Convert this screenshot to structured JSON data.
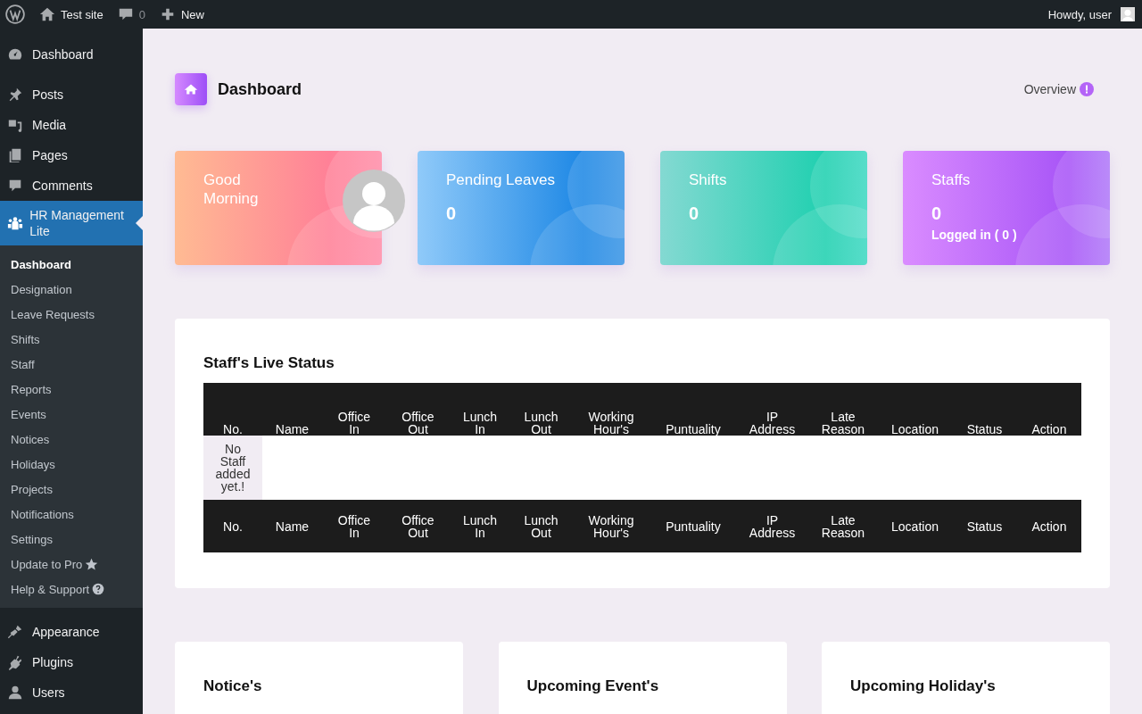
{
  "admin_bar": {
    "site": "Test site",
    "comments": "0",
    "new": "New",
    "greeting": "Howdy, user"
  },
  "sidebar": {
    "items": [
      {
        "label": "Dashboard",
        "selected": false
      },
      {
        "label": "Posts",
        "selected": false
      },
      {
        "label": "Media",
        "selected": false
      },
      {
        "label": "Pages",
        "selected": false
      },
      {
        "label": "Comments",
        "selected": false
      },
      {
        "label": "HR Management Lite",
        "selected": true
      }
    ],
    "submenu": [
      {
        "label": "Dashboard",
        "selected": true,
        "kind": "link"
      },
      {
        "label": "Designation",
        "selected": false,
        "kind": "link"
      },
      {
        "label": "Leave Requests",
        "selected": false,
        "kind": "link"
      },
      {
        "label": "Shifts",
        "selected": false,
        "kind": "link"
      },
      {
        "label": "Staff",
        "selected": false,
        "kind": "link"
      },
      {
        "label": "Reports",
        "selected": false,
        "kind": "link"
      },
      {
        "label": "Events",
        "selected": false,
        "kind": "link"
      },
      {
        "label": "Notices",
        "selected": false,
        "kind": "link"
      },
      {
        "label": "Holidays",
        "selected": false,
        "kind": "link"
      },
      {
        "label": "Projects",
        "selected": false,
        "kind": "link"
      },
      {
        "label": "Notifications",
        "selected": false,
        "kind": "link"
      },
      {
        "label": "Settings",
        "selected": false,
        "kind": "link"
      },
      {
        "label": "Update to Pro",
        "selected": false,
        "kind": "pro"
      },
      {
        "label": "Help & Support",
        "selected": false,
        "kind": "help"
      }
    ],
    "lower_items": [
      {
        "label": "Appearance",
        "selected": false
      },
      {
        "label": "Plugins",
        "selected": false
      },
      {
        "label": "Users",
        "selected": false
      }
    ]
  },
  "page": {
    "title": "Dashboard",
    "overview": "Overview"
  },
  "stat_cards": [
    {
      "kind": "greeting",
      "title": "Good Morning"
    },
    {
      "kind": "count",
      "title": "Pending Leaves",
      "value": "0"
    },
    {
      "kind": "count",
      "title": "Shifts",
      "value": "0"
    },
    {
      "kind": "count",
      "title": "Staffs",
      "value": "0",
      "sub": "Logged in ( 0 )"
    }
  ],
  "live_status": {
    "title": "Staff's Live Status",
    "columns": [
      "No.",
      "Name",
      "Office In",
      "Office Out",
      "Lunch In",
      "Lunch Out",
      "Working Hour's",
      "Puntuality",
      "IP Address",
      "Late Reason",
      "Location",
      "Status",
      "Action"
    ],
    "empty_message": "No Staff added yet.!",
    "footer_columns": [
      "No.",
      "Name",
      "Office In",
      "Office Out",
      "Lunch In",
      "Lunch Out",
      "Working Hour's",
      "Puntuality",
      "IP Address",
      "Late Reason",
      "Location",
      "Status",
      "Action"
    ]
  },
  "panels": [
    {
      "title": "Notice's"
    },
    {
      "title": "Upcoming Event's"
    },
    {
      "title": "Upcoming Holiday's"
    }
  ]
}
